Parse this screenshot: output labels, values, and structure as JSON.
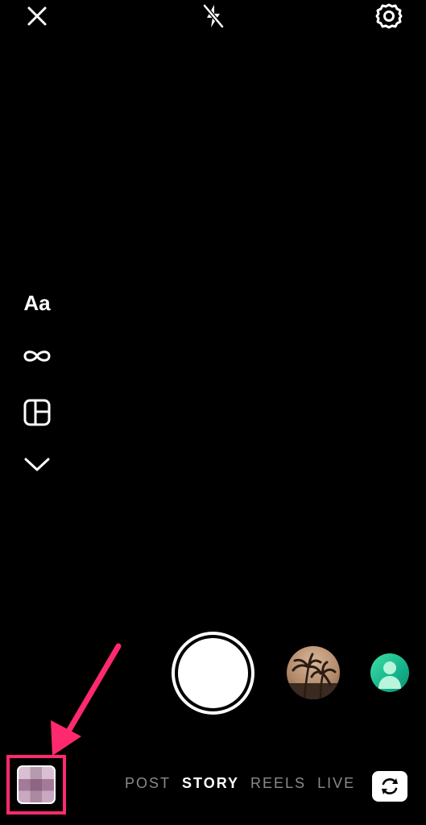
{
  "top_bar": {
    "close_icon": "close-icon",
    "flash_icon": "flash-off-icon",
    "settings_icon": "gear-icon"
  },
  "tools": {
    "create_label": "Aa",
    "boomerang_icon": "infinity-icon",
    "layout_icon": "layout-grid-icon",
    "more_icon": "chevron-down-icon"
  },
  "capture": {
    "shutter_icon": "shutter-button",
    "effect_preview_icon": "palm-trees-effect-icon",
    "profile_icon": "avatar-icon"
  },
  "modes": [
    {
      "label": "POST",
      "active": false
    },
    {
      "label": "STORY",
      "active": true
    },
    {
      "label": "REELS",
      "active": false
    },
    {
      "label": "LIVE",
      "active": false
    }
  ],
  "bottom": {
    "gallery_icon": "gallery-thumbnail",
    "flip_camera_icon": "flip-camera-icon"
  },
  "colors": {
    "background": "#000000",
    "foreground": "#ffffff",
    "inactive_mode": "#8a8a8a",
    "highlight": "#ff2a6e"
  }
}
